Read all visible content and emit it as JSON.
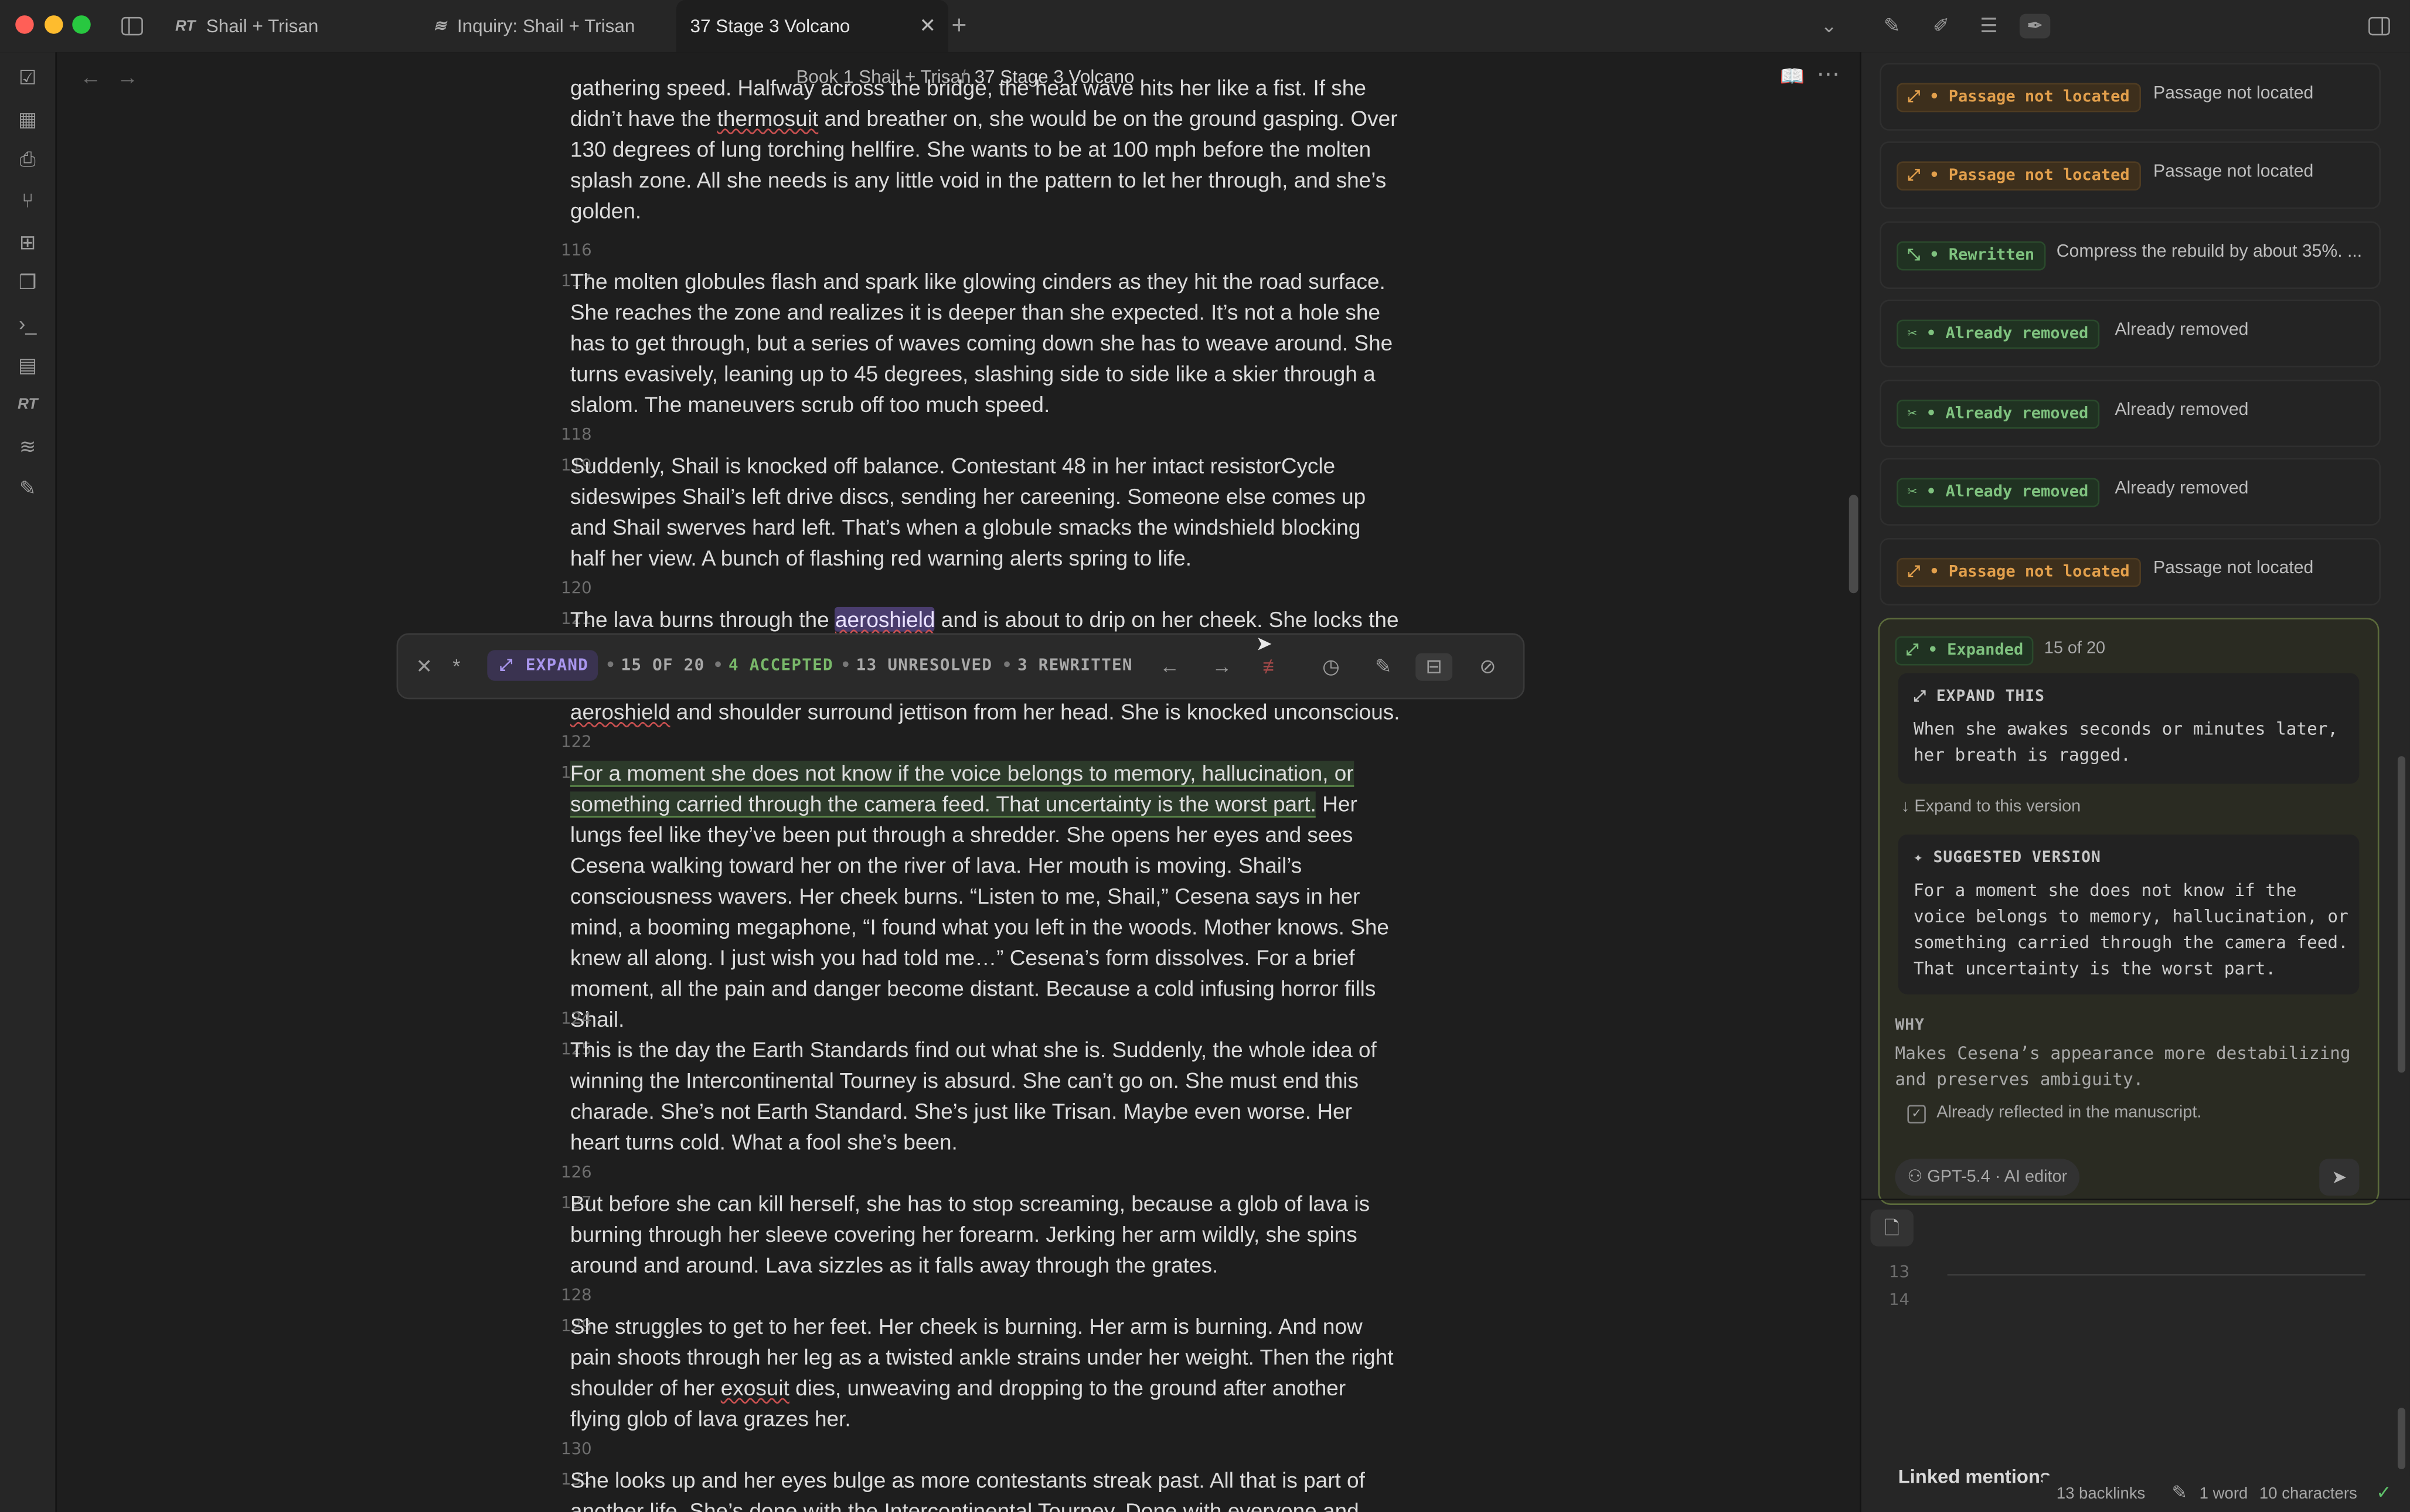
{
  "window": {
    "tabs": [
      {
        "icon": "RT",
        "label": "Shail + Trisan"
      },
      {
        "icon": "≋",
        "label": "Inquiry: Shail + Trisan"
      },
      {
        "icon": "",
        "label": "37 Stage 3 Volcano"
      }
    ]
  },
  "breadcrumb": {
    "parent": "Book 1 Shail + Trisan",
    "sep": "/",
    "current": "37 Stage 3 Volcano"
  },
  "editor": {
    "lines": [
      {
        "n": "",
        "text": "gathering speed. Halfway across the bridge, the heat wave hits her like a fist. If she didn’t have the thermosuit and breather on, she would be on the ground gasping. Over 130 degrees of lung torching hellfire. She wants to be at 100 mph before the molten splash zone. All she needs is any little void in the pattern to let her through, and she’s golden."
      },
      {
        "n": "116",
        "text": ""
      },
      {
        "n": "117",
        "text": "The molten globules flash and spark like glowing cinders as they hit the road surface. She reaches the zone and realizes it is deeper than she expected. It’s not a hole she has to get through, but a series of waves coming down she has to weave around. She turns evasively, leaning up to 45 degrees, slashing side to side like a skier through a slalom. The maneuvers scrub off too much speed."
      },
      {
        "n": "118",
        "text": ""
      },
      {
        "n": "119",
        "text": "Suddenly, Shail is knocked off balance. Contestant 48 in her intact resistorCycle sideswipes Shail’s left drive discs, sending her careening. Someone else comes up and Shail swerves hard left. That’s when a globule smacks the windshield blocking half her view. A bunch of flashing red warning alerts spring to life."
      },
      {
        "n": "120",
        "text": ""
      },
      {
        "n": "121",
        "text_a": "The lava burns through the ",
        "highlight": "aeroshield",
        "text_b": " and is about to drip on her cheek. She locks the",
        "cont_word": "aeroshield",
        "cont_rest": " and shoulder surround jettison from her head. She is knocked unconscious."
      },
      {
        "n": "122",
        "text": ""
      },
      {
        "n": "123",
        "accepted": "For a moment she does not know if the voice belongs to memory, hallucination, or something carried through the camera feed. That uncertainty is the worst part.",
        "rest": " Her lungs feel like they’ve been put through a shredder. She opens her eyes and sees Cesena walking toward her on the river of lava. Her mouth is moving. Shail’s consciousness wavers. Her cheek burns. “Listen to me, Shail,” Cesena says in her mind, a booming megaphone, “I found what you left in the woods. Mother knows. She knew all along. I just wish you had told me…” Cesena’s form dissolves. For a brief moment, all the pain and danger become distant. Because a cold infusing horror fills Shail."
      },
      {
        "n": "124",
        "text": ""
      },
      {
        "n": "125",
        "text": "This is the day the Earth Standards find out what she is. Suddenly, the whole idea of winning the Intercontinental Tourney is absurd. She can’t go on. She must end this charade. She’s not Earth Standard. She’s just like Trisan. Maybe even worse. Her heart turns cold. What a fool she’s been."
      },
      {
        "n": "126",
        "text": ""
      },
      {
        "n": "127",
        "text": "But before she can kill herself, she has to stop screaming, because a glob of lava is burning through her sleeve covering her forearm. Jerking her arm wildly, she spins around and around. Lava sizzles as it falls away through the grates."
      },
      {
        "n": "128",
        "text": ""
      },
      {
        "n": "129",
        "text_a": "She struggles to get to her feet. Her cheek is burning. Her arm is burning. And now pain shoots through her leg as a twisted ankle strains under her weight. Then the right shoulder of her ",
        "underline": "exosuit",
        "text_b": " dies, unweaving and dropping to the ground after another flying glob of lava grazes her."
      },
      {
        "n": "130",
        "text": ""
      },
      {
        "n": "131",
        "text": "She looks up and her eyes bulge as more contestants streak past. All that is part of another life. She’s done with the Intercontinental Tourney. Done with everyone and"
      }
    ],
    "underlined_words": [
      "thermosuit",
      "aeroshield",
      "exosuit"
    ]
  },
  "toolbar": {
    "mode": "EXPAND",
    "position": "15 OF 20",
    "accepted": "4 ACCEPTED",
    "unresolved": "13 UNRESOLVED",
    "rewritten": "3 REWRITTEN",
    "sep": "•"
  },
  "panel": {
    "cards": [
      {
        "kind": "orange",
        "badge": "• Passage not located",
        "text": "Passage not located"
      },
      {
        "kind": "orange",
        "badge": "• Passage not located",
        "text": "Passage not located"
      },
      {
        "kind": "green",
        "badge": "• Rewritten",
        "text": "Compress the rebuild by about 35%. ..."
      },
      {
        "kind": "green",
        "badge": "• Already removed",
        "text": "Already removed"
      },
      {
        "kind": "green",
        "badge": "• Already removed",
        "text": "Already removed"
      },
      {
        "kind": "green",
        "badge": "• Already removed",
        "text": "Already removed"
      },
      {
        "kind": "orange",
        "badge": "• Passage not located",
        "text": "Passage not located"
      }
    ],
    "expanded": {
      "badge": "• Expanded",
      "count": "15 of 20",
      "expand_label": "EXPAND THIS",
      "expand_text": "When she awakes seconds or minutes later, her breath is ragged.",
      "expand_link": "Expand to this version",
      "suggested_label": "SUGGESTED VERSION",
      "suggested_text": "For a moment she does not know if the voice belongs to memory, hallucination, or something carried through the camera feed. That uncertainty is the worst part.",
      "why_label": "WHY",
      "why_text": "Makes Cesena’s appearance more destabilizing and preserves ambiguity.",
      "reflected": "Already reflected in the manuscript.",
      "model": "GPT-5.4 · AI editor"
    },
    "mini_lines": [
      "13",
      "14"
    ],
    "linked_mentions": "Linked mentions",
    "status": {
      "backlinks": "13 backlinks",
      "words": "1 word",
      "chars": "10 characters"
    }
  },
  "colors": {
    "accent": "#8b6fd6",
    "accepted": "#79b86a",
    "orange": "#e3a04c"
  }
}
